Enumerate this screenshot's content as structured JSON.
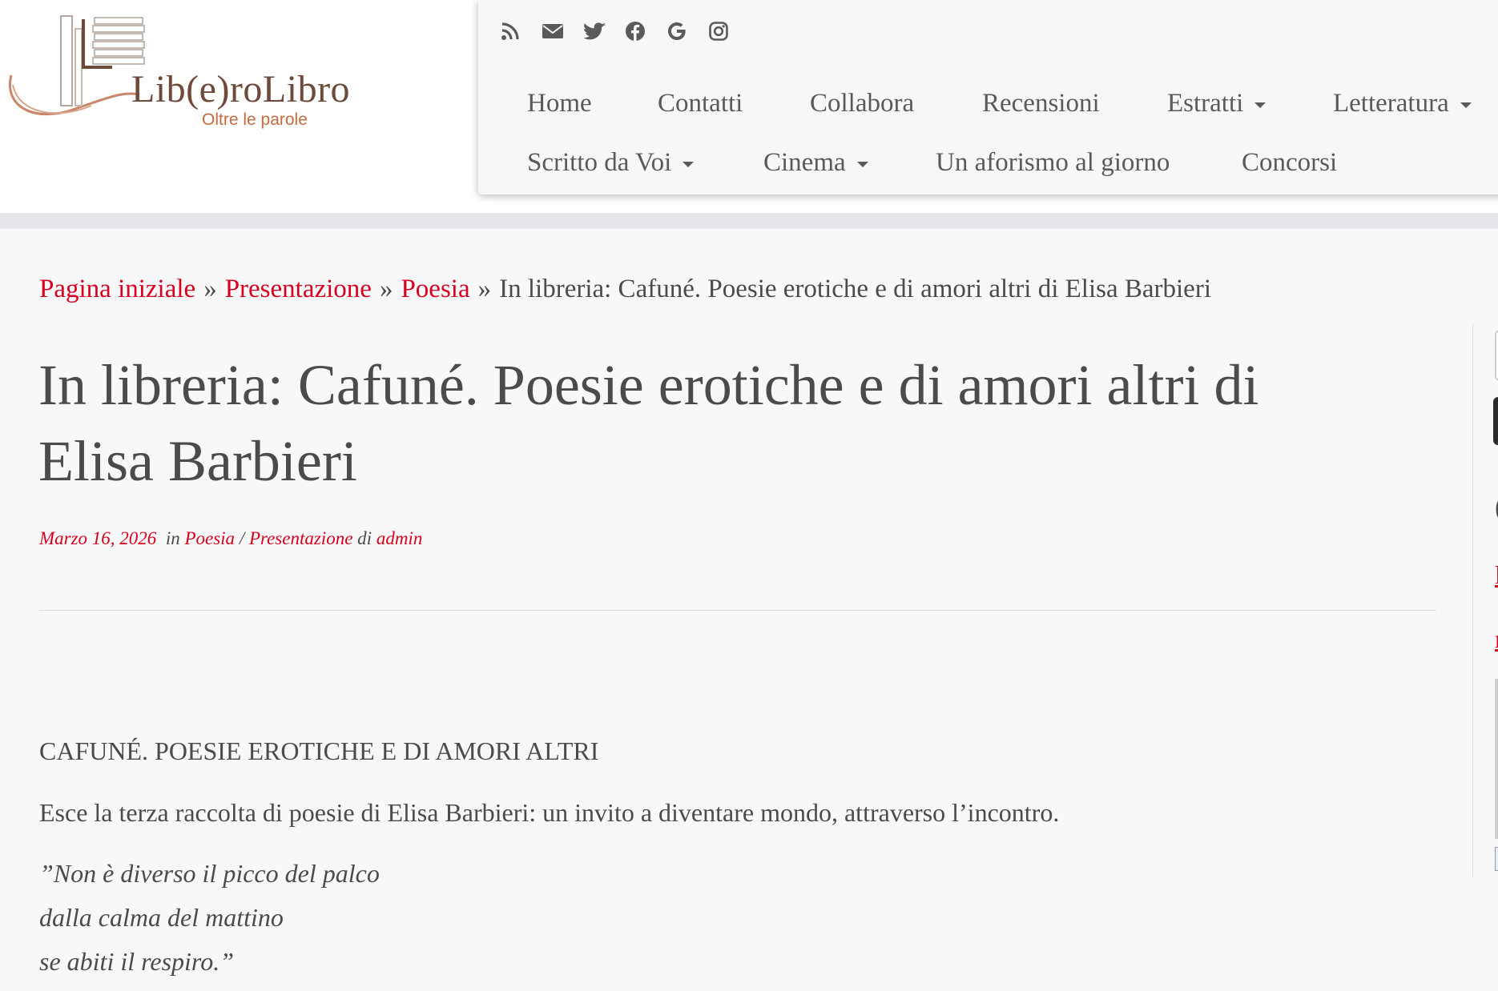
{
  "logo": {
    "name": "Lib(e)roLibro",
    "tagline": "Oltre le parole"
  },
  "social": [
    "rss-icon",
    "envelope-icon",
    "twitter-icon",
    "facebook-icon",
    "google-icon",
    "instagram-icon"
  ],
  "nav": {
    "row1": [
      {
        "label": "Home",
        "dropdown": false
      },
      {
        "label": "Contatti",
        "dropdown": false
      },
      {
        "label": "Collabora",
        "dropdown": false
      },
      {
        "label": "Recensioni",
        "dropdown": false
      },
      {
        "label": "Estratti",
        "dropdown": true
      },
      {
        "label": "Letteratura",
        "dropdown": true
      }
    ],
    "row2": [
      {
        "label": "Scritto da Voi",
        "dropdown": true
      },
      {
        "label": "Cinema",
        "dropdown": true
      },
      {
        "label": "Un aforismo al giorno",
        "dropdown": false
      },
      {
        "label": "Concorsi",
        "dropdown": false
      }
    ]
  },
  "breadcrumb": {
    "home": "Pagina iniziale",
    "level1": "Presentazione",
    "level2": "Poesia",
    "separator": "»",
    "current": "In libreria: Cafuné. Poesie erotiche e di amori altri di Elisa Barbieri"
  },
  "article": {
    "title_line1": "In libreria: Cafuné. Poesie erotiche e di amori altri di",
    "title_line2": "Elisa Barbieri",
    "date": "Marzo 16, 2026",
    "in_label": "in",
    "category1": "Poesia",
    "cat_sep": "/",
    "category2": "Presentazione",
    "by_label": "di",
    "author": "admin",
    "subheading": "CAFUNÉ. POESIE EROTICHE E DI AMORI ALTRI",
    "intro": "Esce la terza raccolta di poesie di Elisa Barbieri: un invito a diventare mondo, attraverso l’incontro.",
    "verse": [
      "”Non è diverso il picco del palco",
      "dalla calma del mattino",
      "se abiti il respiro.”"
    ]
  },
  "sidebar": {
    "char1": "(",
    "link1": "l",
    "link2": "r"
  },
  "colors": {
    "accent": "#d8001f",
    "text": "#4b4b4b",
    "nav_bg": "#f7f7f7",
    "page_bg": "#f8f8f8"
  }
}
